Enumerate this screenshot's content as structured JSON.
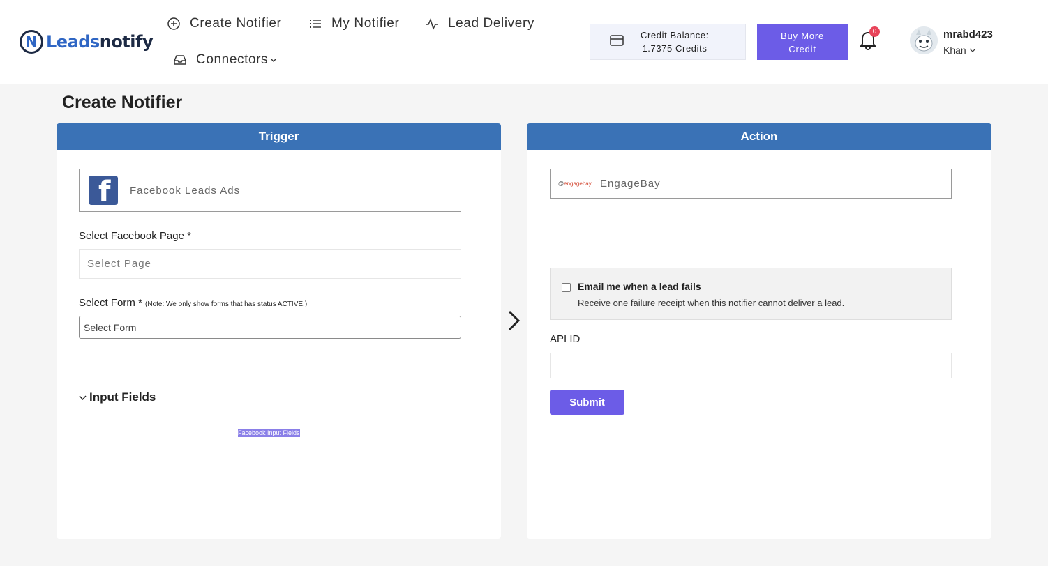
{
  "brand": {
    "part1": "Leads",
    "part2": "notify"
  },
  "nav": {
    "create_notifier": "Create Notifier",
    "my_notifier": "My Notifier",
    "lead_delivery": "Lead Delivery",
    "connectors": "Connectors"
  },
  "credit": {
    "line1": "Credit Balance:",
    "line2": "1.7375 Credits"
  },
  "buy": {
    "line1": "Buy More",
    "line2": "Credit"
  },
  "notifications": {
    "count": "0"
  },
  "user": {
    "name": "mrabd423",
    "sub": "Khan"
  },
  "page": {
    "title": "Create Notifier"
  },
  "trigger": {
    "header": "Trigger",
    "app_name": "Facebook Leads Ads",
    "page_label": "Select Facebook Page *",
    "page_placeholder": "Select Page",
    "form_label": "Select Form *",
    "form_note": "(Note: We only show forms that has status ACTIVE.)",
    "form_placeholder": "Select Form",
    "input_fields_heading": "Input Fields",
    "input_fields_tag": "Facebook Input Fields"
  },
  "action": {
    "header": "Action",
    "app_logo_text": "engagebay",
    "app_name": "EngageBay",
    "fail_title": "Email me when a lead fails",
    "fail_desc": "Receive one failure receipt when this notifier cannot deliver a lead.",
    "api_label": "API ID",
    "api_value": "",
    "submit": "Submit"
  },
  "colors": {
    "accent": "#6c5ce7",
    "panel_header": "#3a72b6",
    "badge": "#e8445a"
  },
  "icons": {
    "create": "plus-circle-icon",
    "list": "list-icon",
    "activity": "activity-icon",
    "connectors": "inbox-icon",
    "credit": "credit-card-icon",
    "bell": "bell-icon"
  }
}
